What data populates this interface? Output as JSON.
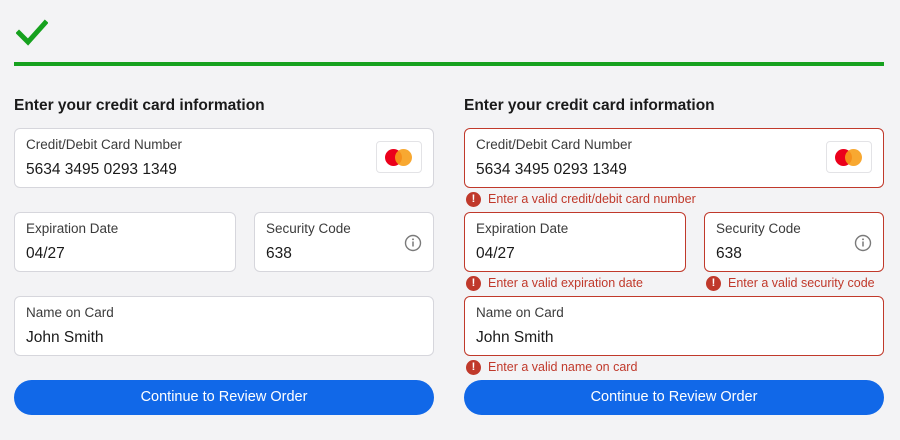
{
  "status": {
    "icon": "checkmark-icon",
    "color": "#16a11e"
  },
  "colors": {
    "accent": "#1168e8",
    "success": "#16a11e",
    "error": "#c0392b",
    "mastercard_red": "#eb001b",
    "mastercard_orange": "#f79e1b"
  },
  "forms": {
    "valid": {
      "title": "Enter your credit card information",
      "card": {
        "label": "Credit/Debit Card Number",
        "value": "5634 3495 0293 1349",
        "brand_icon": "mastercard-logo-icon"
      },
      "expiration": {
        "label": "Expiration Date",
        "value": "04/27"
      },
      "security": {
        "label": "Security Code",
        "value": "638",
        "icon": "info-icon"
      },
      "name": {
        "label": "Name on Card",
        "value": "John Smith"
      },
      "button": "Continue to Review Order"
    },
    "invalid": {
      "title": "Enter your credit card information",
      "card": {
        "label": "Credit/Debit Card Number",
        "value": "5634 3495 0293 1349",
        "brand_icon": "mastercard-logo-icon",
        "error": "Enter a valid credit/debit card number"
      },
      "expiration": {
        "label": "Expiration Date",
        "value": "04/27",
        "error": "Enter a valid expiration date"
      },
      "security": {
        "label": "Security Code",
        "value": "638",
        "icon": "info-icon",
        "error": "Enter a valid security code"
      },
      "name": {
        "label": "Name on Card",
        "value": "John Smith",
        "error": "Enter a valid name on card"
      },
      "button": "Continue to Review Order"
    }
  }
}
